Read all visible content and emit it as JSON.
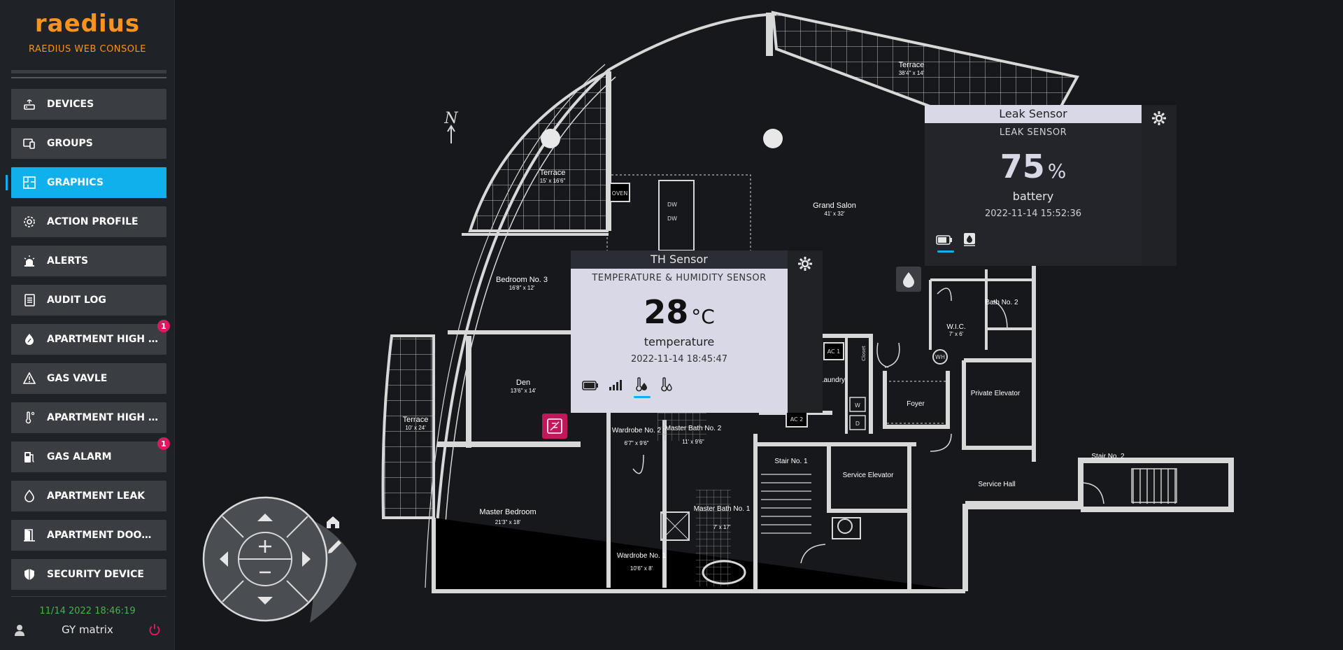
{
  "app": {
    "logo": "raedius",
    "console_title": "RAEDIUS WEB CONSOLE"
  },
  "sidebar": {
    "items": [
      {
        "label": "DEVICES",
        "icon": "router-icon",
        "active": false,
        "badge": ""
      },
      {
        "label": "GROUPS",
        "icon": "devices-group-icon",
        "active": false,
        "badge": ""
      },
      {
        "label": "GRAPHICS",
        "icon": "floorplan-icon",
        "active": true,
        "badge": ""
      },
      {
        "label": "ACTION PROFILE",
        "icon": "gear-icon",
        "active": false,
        "badge": ""
      },
      {
        "label": "ALERTS",
        "icon": "alarm-light-icon",
        "active": false,
        "badge": ""
      },
      {
        "label": "AUDIT LOG",
        "icon": "log-icon",
        "active": false,
        "badge": ""
      },
      {
        "label": "APARTMENT HIGH TE...",
        "icon": "flame-drop-icon",
        "active": false,
        "badge": "1"
      },
      {
        "label": "GAS VAVLE",
        "icon": "warning-icon",
        "active": false,
        "badge": ""
      },
      {
        "label": "APARTMENT HIGH TE...",
        "icon": "thermometer-icon",
        "active": false,
        "badge": ""
      },
      {
        "label": "GAS ALARM",
        "icon": "gas-pump-icon",
        "active": false,
        "badge": "1"
      },
      {
        "label": "APARTMENT LEAK",
        "icon": "water-drop-icon",
        "active": false,
        "badge": ""
      },
      {
        "label": "APARTMENT DOOR S...",
        "icon": "door-icon",
        "active": false,
        "badge": ""
      },
      {
        "label": "SECURITY DEVICE",
        "icon": "shield-icon",
        "active": false,
        "badge": ""
      }
    ]
  },
  "footer": {
    "datetime": "11/14 2022 18:46:19",
    "user": "GY matrix"
  },
  "floorplan": {
    "rooms": [
      {
        "name": "Terrace",
        "size": "38'4\" x 14'"
      },
      {
        "name": "Terrace",
        "size": "15' x 16'6\""
      },
      {
        "name": "Grand Salon",
        "size": "41' x 32'"
      },
      {
        "name": "Bedroom No. 3",
        "size": "16'8\" x 12'"
      },
      {
        "name": "Den",
        "size": "13'6\" x 14'"
      },
      {
        "name": "Terrace",
        "size": "10' x 24'"
      },
      {
        "name": "Master Bedroom",
        "size": "21'3\" x 18'"
      },
      {
        "name": "Wardrobe No. 2",
        "size": "6'7\" x 9'6\""
      },
      {
        "name": "Master Bath No. 2",
        "size": "11' x 9'6\""
      },
      {
        "name": "Master Bath No. 1",
        "size": "7' x 17'"
      },
      {
        "name": "Wardrobe No. 1",
        "size": "10'6\" x 8'"
      },
      {
        "name": "Stair No. 1",
        "size": ""
      },
      {
        "name": "Service Elevator",
        "size": ""
      },
      {
        "name": "Service Hall",
        "size": ""
      },
      {
        "name": "Stair No. 2",
        "size": ""
      },
      {
        "name": "Foyer",
        "size": ""
      },
      {
        "name": "Private Elevator",
        "size": ""
      },
      {
        "name": "W.I.C.",
        "size": "7' x 6'"
      },
      {
        "name": "Bath No. 2",
        "size": ""
      },
      {
        "name": "Laundry",
        "size": ""
      }
    ],
    "labels": {
      "oven": "OVEN",
      "dw1": "DW",
      "dw2": "DW",
      "ac1": "AC 1",
      "ac2": "AC 2",
      "closet": "Closet",
      "wh": "WH",
      "w": "W",
      "d": "D",
      "north": "N"
    }
  },
  "leak_popup": {
    "title": "Leak Sensor",
    "type": "LEAK SENSOR",
    "value": "75",
    "unit": "%",
    "metric": "battery",
    "timestamp": "2022-11-14 15:52:36"
  },
  "th_popup": {
    "title": "TH Sensor",
    "type": "TEMPERATURE & HUMIDITY SENSOR",
    "value": "28",
    "unit": "°C",
    "metric": "temperature",
    "timestamp": "2022-11-14 18:45:47"
  },
  "colors": {
    "accent": "#10b0ec",
    "brand": "#f7931e",
    "badge": "#d81b60",
    "clock": "#4caf50"
  }
}
